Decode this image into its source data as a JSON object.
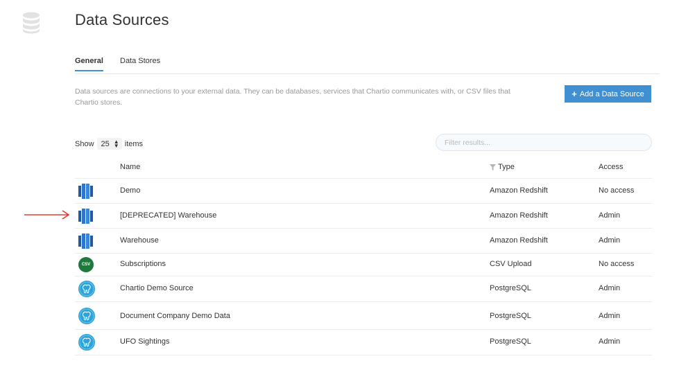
{
  "page": {
    "title": "Data Sources",
    "logo_icon": "database-icon"
  },
  "tabs": [
    {
      "label": "General",
      "active": true
    },
    {
      "label": "Data Stores",
      "active": false
    }
  ],
  "description": "Data sources are connections to your external data. They can be databases, services that Chartio communicates with, or CSV files that Chartio stores.",
  "add_button": {
    "label": "Add a Data Source",
    "icon": "plus-icon"
  },
  "show": {
    "prefix": "Show",
    "value": "25",
    "suffix": "items"
  },
  "filter": {
    "placeholder": "Filter results..."
  },
  "table": {
    "headers": {
      "name": "Name",
      "type": "Type",
      "access": "Access"
    },
    "type_header_icon": "filter-icon",
    "rows": [
      {
        "icon": "amazon-redshift-icon",
        "name": "Demo",
        "type": "Amazon Redshift",
        "access": "No access"
      },
      {
        "icon": "amazon-redshift-icon",
        "name": "[DEPRECATED] Warehouse",
        "type": "Amazon Redshift",
        "access": "Admin"
      },
      {
        "icon": "amazon-redshift-icon",
        "name": "Warehouse",
        "type": "Amazon Redshift",
        "access": "Admin"
      },
      {
        "icon": "csv-icon",
        "icon_text": "CSV",
        "name": "Subscriptions",
        "type": "CSV Upload",
        "access": "No access"
      },
      {
        "icon": "postgresql-icon",
        "name": "Chartio Demo Source",
        "type": "PostgreSQL",
        "access": "Admin"
      },
      {
        "icon": "postgresql-icon",
        "name": "Document Company Demo Data",
        "type": "PostgreSQL",
        "access": "Admin"
      },
      {
        "icon": "postgresql-icon",
        "name": "UFO Sightings",
        "type": "PostgreSQL",
        "access": "Admin"
      }
    ]
  },
  "annotation": {
    "icon": "red-arrow-icon",
    "color": "#e03b2e"
  },
  "colors": {
    "accent": "#3f8fd2",
    "redshift": "#2b6cb8",
    "csv": "#1e7a3c",
    "postgres": "#2fa3d8"
  }
}
